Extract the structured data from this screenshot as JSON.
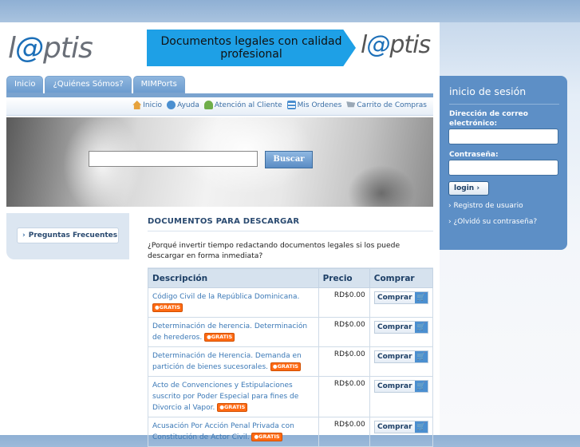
{
  "header": {
    "logo_prefix": "l",
    "logo_at": "@",
    "logo_suffix": "ptis",
    "banner_text": "Documentos legales con calidad profesional",
    "banner_logo_prefix": "l",
    "banner_logo_at": "@",
    "banner_logo_suffix": "ptis"
  },
  "tabs": [
    {
      "label": "Inicio"
    },
    {
      "label": "¿Quiénes Sómos?"
    },
    {
      "label": "MIMPorts"
    }
  ],
  "subnav": [
    {
      "label": "Inicio",
      "icon": "home-icon",
      "color": "#e6a23c"
    },
    {
      "label": "Ayuda",
      "icon": "help-icon",
      "color": "#4b8fd0"
    },
    {
      "label": "Atención al Cliente",
      "icon": "people-icon",
      "color": "#6fae4a"
    },
    {
      "label": "Mis Ordenes",
      "icon": "list-icon",
      "color": "#4b8fd0"
    },
    {
      "label": "Carrito de Compras",
      "icon": "cart-icon",
      "color": "#9aa8b6"
    }
  ],
  "search": {
    "value": "",
    "button_label": "Buscar"
  },
  "sidebar": {
    "faq_label": "Preguntas Frecuentes"
  },
  "main": {
    "title": "DOCUMENTOS PARA DESCARGAR",
    "intro": "¿Porqué invertir tiempo redactando documentos legales si los puede descargar en forma inmediata?"
  },
  "table": {
    "headers": {
      "desc": "Descripción",
      "price": "Precio",
      "buy": "Comprar"
    },
    "badge": "GRATIS",
    "buy_label": "Comprar",
    "rows": [
      {
        "desc": "Código Civil de la República Dominicana.",
        "price": "RD$0.00"
      },
      {
        "desc": "Determinación de herencia. Determinación de herederos.",
        "price": "RD$0.00"
      },
      {
        "desc": "Determinación de Herencia. Demanda en partición de bienes sucesorales.",
        "price": "RD$0.00"
      },
      {
        "desc": "Acto de Convenciones y Estipulaciones suscrito por Poder Especial para fines de Divorcio al Vapor.",
        "price": "RD$0.00"
      },
      {
        "desc": "Acusación Por Acción Penal Privada con Constitución de Actor Civil.",
        "price": "RD$0.00"
      }
    ]
  },
  "login": {
    "title": "inicio de sesión",
    "email_label": "Dirección de correo electrónico:",
    "email_value": "",
    "password_label": "Contraseña:",
    "password_value": "",
    "button_label": "login",
    "register_link": "Registro de usuario",
    "forgot_link": "¿Olvidó su contraseña?"
  },
  "colors": {
    "accent": "#5d8fc6",
    "badge": "#ff6a13",
    "link": "#3a78b6"
  }
}
